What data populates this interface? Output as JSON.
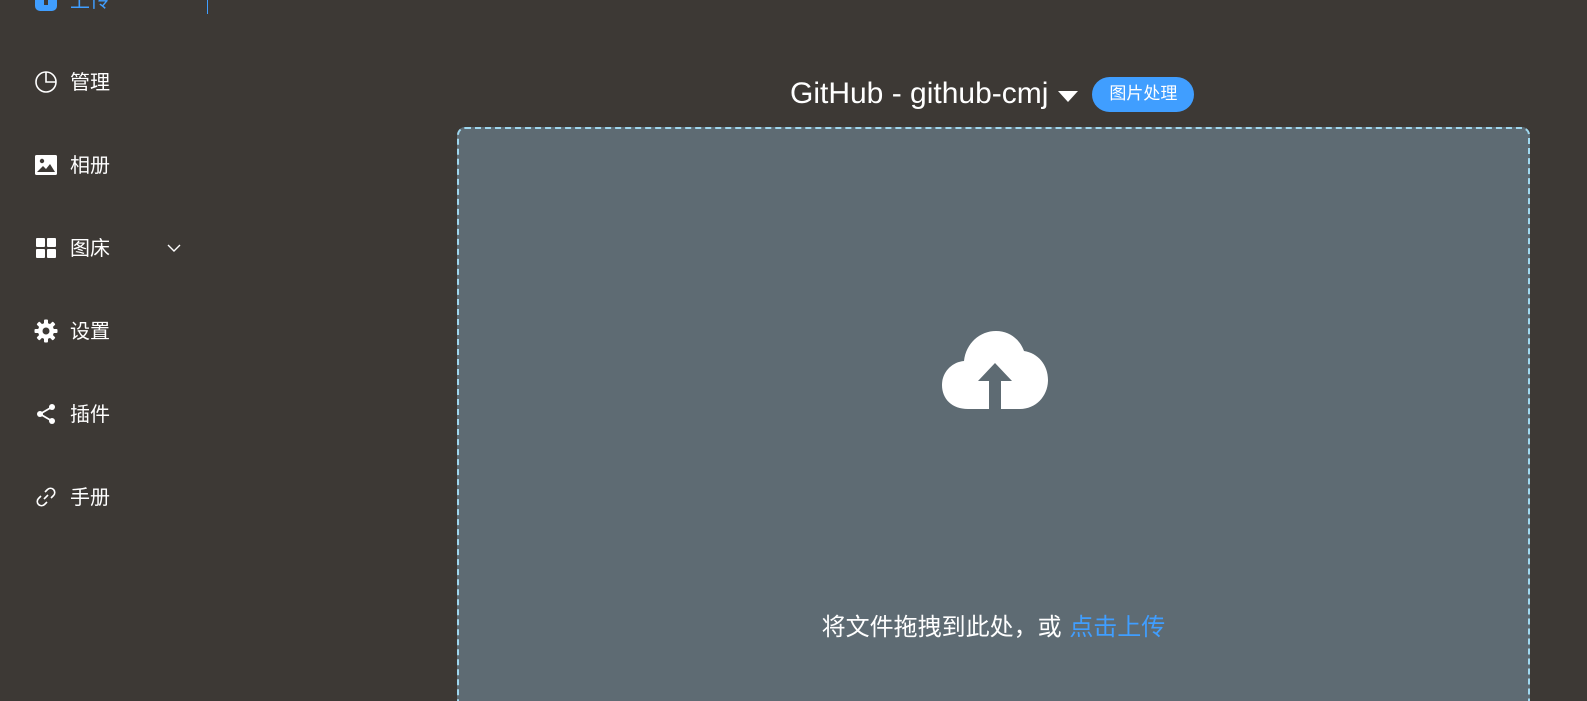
{
  "sidebar": {
    "items": [
      {
        "label": "上传",
        "icon": "upload-icon"
      },
      {
        "label": "管理",
        "icon": "pie-chart-icon"
      },
      {
        "label": "相册",
        "icon": "picture-icon"
      },
      {
        "label": "图床",
        "icon": "grid-icon"
      },
      {
        "label": "设置",
        "icon": "gear-icon"
      },
      {
        "label": "插件",
        "icon": "share-icon"
      },
      {
        "label": "手册",
        "icon": "link-icon"
      }
    ],
    "active_color": "#409eff"
  },
  "header": {
    "picbed_title": "GitHub - github-cmj",
    "badge": "图片处理"
  },
  "dropzone": {
    "text": "将文件拖拽到此处，或 ",
    "link": "点击上传",
    "icon": "cloud-upload-icon"
  },
  "colors": {
    "background": "#3d3935",
    "accent": "#409eff",
    "dropzone_bg": "#5e6b73",
    "dropzone_border": "#9fd8f0"
  }
}
